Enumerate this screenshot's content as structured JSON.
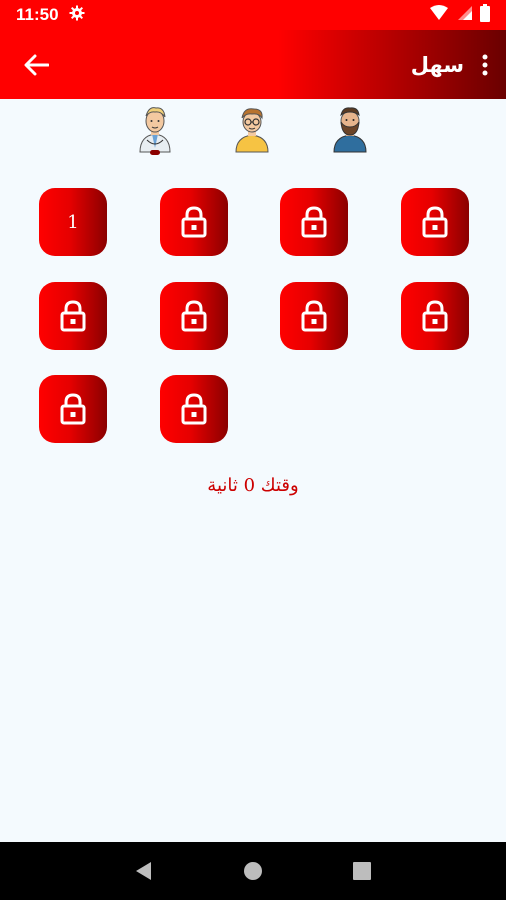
{
  "status_bar": {
    "time": "11:50"
  },
  "app_bar": {
    "title": "سهل"
  },
  "players": [
    "doctor-avatar",
    "boy-with-glasses-avatar",
    "bearded-man-avatar"
  ],
  "tiles": [
    {
      "label": "1",
      "locked": false
    },
    {
      "label": "",
      "locked": true
    },
    {
      "label": "",
      "locked": true
    },
    {
      "label": "",
      "locked": true
    },
    {
      "label": "",
      "locked": true
    },
    {
      "label": "",
      "locked": true
    },
    {
      "label": "",
      "locked": true
    },
    {
      "label": "",
      "locked": true
    },
    {
      "label": "",
      "locked": true
    },
    {
      "label": "",
      "locked": true
    }
  ],
  "timer": {
    "text": "وقتك 0 ثانية"
  },
  "colors": {
    "primary": "#ff0000",
    "dark_red": "#6a0000",
    "background": "#f4fafe"
  }
}
